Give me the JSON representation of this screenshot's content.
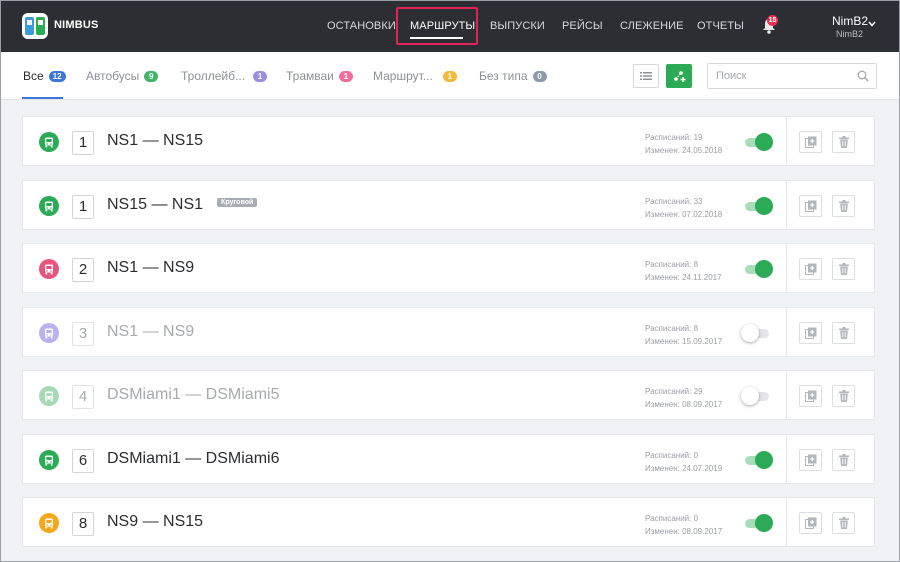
{
  "app": {
    "brand": "NIMBUS"
  },
  "nav": {
    "items": [
      {
        "label": "ОСТАНОВКИ",
        "active": false
      },
      {
        "label": "МАРШРУТЫ",
        "active": true
      },
      {
        "label": "ВЫПУСКИ",
        "active": false
      },
      {
        "label": "РЕЙСЫ",
        "active": false
      },
      {
        "label": "СЛЕЖЕНИЕ",
        "active": false
      },
      {
        "label": "ОТЧЕТЫ",
        "active": false
      }
    ],
    "notifications_count": "15"
  },
  "user": {
    "name": "NimB2",
    "sub": "NimB2"
  },
  "filters": {
    "tabs": [
      {
        "label": "Все",
        "count": "12",
        "color": "#3d76d8",
        "active": true
      },
      {
        "label": "Автобусы",
        "count": "9",
        "color": "#43b36b",
        "active": false
      },
      {
        "label": "Троллейб...",
        "count": "1",
        "color": "#9b8de0",
        "active": false
      },
      {
        "label": "Трамваи",
        "count": "1",
        "color": "#ee6f9b",
        "active": false
      },
      {
        "label": "Маршрут...",
        "count": "1",
        "color": "#f4b93a",
        "active": false
      },
      {
        "label": "Без типа",
        "count": "0",
        "color": "#8d9aab",
        "active": false
      }
    ],
    "search_placeholder": "Поиск"
  },
  "routes": [
    {
      "number": "1",
      "name": "NS1 — NS15",
      "tag": "",
      "schedules": "Расписаний: 19",
      "modified": "Изменен: 24.05.2018",
      "enabled": true,
      "type_color": "#2bab55",
      "type_icon": "bus-icon"
    },
    {
      "number": "1",
      "name": "NS15 — NS1",
      "tag": "Круговой",
      "schedules": "Расписаний: 33",
      "modified": "Изменен: 07.02.2018",
      "enabled": true,
      "type_color": "#2bab55",
      "type_icon": "bus-icon"
    },
    {
      "number": "2",
      "name": "NS1 — NS9",
      "tag": "",
      "schedules": "Расписаний: 8",
      "modified": "Изменен: 24.11.2017",
      "enabled": true,
      "type_color": "#e9547f",
      "type_icon": "tram-icon"
    },
    {
      "number": "3",
      "name": "NS1 — NS9",
      "tag": "",
      "schedules": "Расписаний: 8",
      "modified": "Изменен: 15.09.2017",
      "enabled": false,
      "type_color": "#b9b2ee",
      "type_icon": "trolleybus-icon"
    },
    {
      "number": "4",
      "name": "DSMiami1 — DSMiami5",
      "tag": "",
      "schedules": "Расписаний: 29",
      "modified": "Изменен: 08.09.2017",
      "enabled": false,
      "type_color": "#a7d9b5",
      "type_icon": "bus-icon"
    },
    {
      "number": "6",
      "name": "DSMiami1 — DSMiami6",
      "tag": "",
      "schedules": "Расписаний: 0",
      "modified": "Изменен: 24.07.2019",
      "enabled": true,
      "type_color": "#2bab55",
      "type_icon": "bus-icon"
    },
    {
      "number": "8",
      "name": "NS9 — NS15",
      "tag": "",
      "schedules": "Расписаний: 0",
      "modified": "Изменен: 08.09.2017",
      "enabled": true,
      "type_color": "#f4a81b",
      "type_icon": "minibus-icon"
    }
  ],
  "colors": {
    "accent": "#2bab55",
    "nav_bg": "#2d2e33",
    "highlight": "#e02458"
  }
}
